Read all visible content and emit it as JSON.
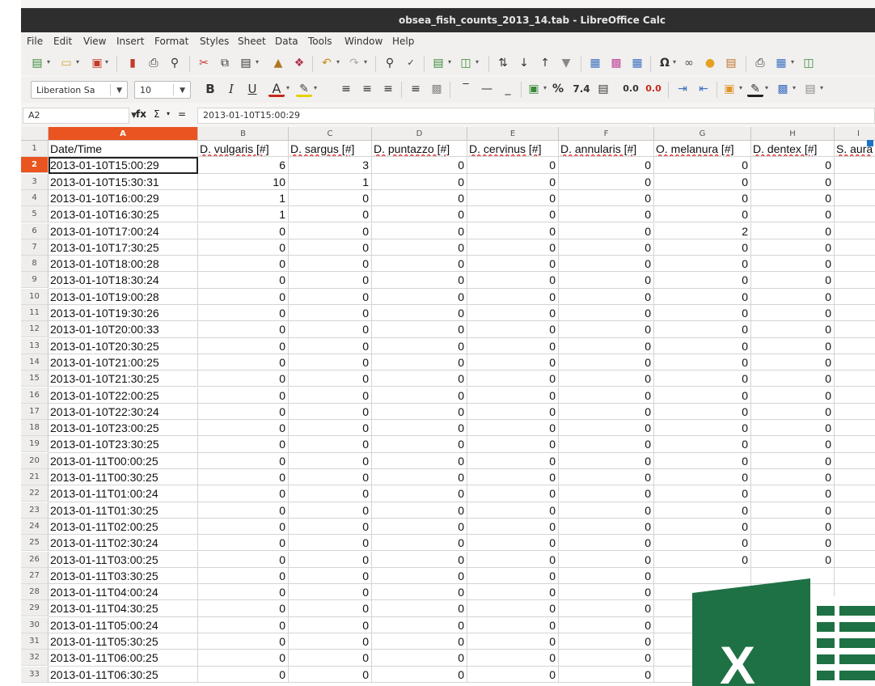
{
  "window": {
    "title": "obsea_fish_counts_2013_14.tab - LibreOffice Calc"
  },
  "menu": [
    "File",
    "Edit",
    "View",
    "Insert",
    "Format",
    "Styles",
    "Sheet",
    "Data",
    "Tools",
    "Window",
    "Help"
  ],
  "formatting": {
    "font_name": "Liberation Sa",
    "font_size": "10",
    "currency": "%",
    "number": "7.4",
    "decimal_add": "0.0",
    "decimal_remove": "0.0"
  },
  "formula_bar": {
    "cell_ref": "A2",
    "fx": "fx",
    "sigma": "Σ",
    "equals": "=",
    "content": "2013-01-10T15:00:29"
  },
  "sheet": {
    "columns": [
      "A",
      "B",
      "C",
      "D",
      "E",
      "F",
      "G",
      "H",
      "I"
    ],
    "headers": [
      "Date/Time",
      "D. vulgaris [#]",
      "D. sargus [#]",
      "D. puntazzo [#]",
      "D. cervinus [#]",
      "D. annularis [#]",
      "O. melanura [#]",
      "D. dentex [#]",
      "S. aura"
    ],
    "rows": [
      {
        "n": "2",
        "date": "2013-01-10T15:00:29",
        "v": [
          "6",
          "3",
          "0",
          "0",
          "0",
          "0",
          "0"
        ]
      },
      {
        "n": "3",
        "date": "2013-01-10T15:30:31",
        "v": [
          "10",
          "1",
          "0",
          "0",
          "0",
          "0",
          "0"
        ]
      },
      {
        "n": "4",
        "date": "2013-01-10T16:00:29",
        "v": [
          "1",
          "0",
          "0",
          "0",
          "0",
          "0",
          "0"
        ]
      },
      {
        "n": "5",
        "date": "2013-01-10T16:30:25",
        "v": [
          "1",
          "0",
          "0",
          "0",
          "0",
          "0",
          "0"
        ]
      },
      {
        "n": "6",
        "date": "2013-01-10T17:00:24",
        "v": [
          "0",
          "0",
          "0",
          "0",
          "0",
          "2",
          "0"
        ]
      },
      {
        "n": "7",
        "date": "2013-01-10T17:30:25",
        "v": [
          "0",
          "0",
          "0",
          "0",
          "0",
          "0",
          "0"
        ]
      },
      {
        "n": "8",
        "date": "2013-01-10T18:00:28",
        "v": [
          "0",
          "0",
          "0",
          "0",
          "0",
          "0",
          "0"
        ]
      },
      {
        "n": "9",
        "date": "2013-01-10T18:30:24",
        "v": [
          "0",
          "0",
          "0",
          "0",
          "0",
          "0",
          "0"
        ]
      },
      {
        "n": "10",
        "date": "2013-01-10T19:00:28",
        "v": [
          "0",
          "0",
          "0",
          "0",
          "0",
          "0",
          "0"
        ]
      },
      {
        "n": "11",
        "date": "2013-01-10T19:30:26",
        "v": [
          "0",
          "0",
          "0",
          "0",
          "0",
          "0",
          "0"
        ]
      },
      {
        "n": "12",
        "date": "2013-01-10T20:00:33",
        "v": [
          "0",
          "0",
          "0",
          "0",
          "0",
          "0",
          "0"
        ]
      },
      {
        "n": "13",
        "date": "2013-01-10T20:30:25",
        "v": [
          "0",
          "0",
          "0",
          "0",
          "0",
          "0",
          "0"
        ]
      },
      {
        "n": "14",
        "date": "2013-01-10T21:00:25",
        "v": [
          "0",
          "0",
          "0",
          "0",
          "0",
          "0",
          "0"
        ]
      },
      {
        "n": "15",
        "date": "2013-01-10T21:30:25",
        "v": [
          "0",
          "0",
          "0",
          "0",
          "0",
          "0",
          "0"
        ]
      },
      {
        "n": "16",
        "date": "2013-01-10T22:00:25",
        "v": [
          "0",
          "0",
          "0",
          "0",
          "0",
          "0",
          "0"
        ]
      },
      {
        "n": "17",
        "date": "2013-01-10T22:30:24",
        "v": [
          "0",
          "0",
          "0",
          "0",
          "0",
          "0",
          "0"
        ]
      },
      {
        "n": "18",
        "date": "2013-01-10T23:00:25",
        "v": [
          "0",
          "0",
          "0",
          "0",
          "0",
          "0",
          "0"
        ]
      },
      {
        "n": "19",
        "date": "2013-01-10T23:30:25",
        "v": [
          "0",
          "0",
          "0",
          "0",
          "0",
          "0",
          "0"
        ]
      },
      {
        "n": "20",
        "date": "2013-01-11T00:00:25",
        "v": [
          "0",
          "0",
          "0",
          "0",
          "0",
          "0",
          "0"
        ]
      },
      {
        "n": "21",
        "date": "2013-01-11T00:30:25",
        "v": [
          "0",
          "0",
          "0",
          "0",
          "0",
          "0",
          "0"
        ]
      },
      {
        "n": "22",
        "date": "2013-01-11T01:00:24",
        "v": [
          "0",
          "0",
          "0",
          "0",
          "0",
          "0",
          "0"
        ]
      },
      {
        "n": "23",
        "date": "2013-01-11T01:30:25",
        "v": [
          "0",
          "0",
          "0",
          "0",
          "0",
          "0",
          "0"
        ]
      },
      {
        "n": "24",
        "date": "2013-01-11T02:00:25",
        "v": [
          "0",
          "0",
          "0",
          "0",
          "0",
          "0",
          "0"
        ]
      },
      {
        "n": "25",
        "date": "2013-01-11T02:30:24",
        "v": [
          "0",
          "0",
          "0",
          "0",
          "0",
          "0",
          "0"
        ]
      },
      {
        "n": "26",
        "date": "2013-01-11T03:00:25",
        "v": [
          "0",
          "0",
          "0",
          "0",
          "0",
          "0",
          "0"
        ]
      },
      {
        "n": "27",
        "date": "2013-01-11T03:30:25",
        "v": [
          "0",
          "0",
          "0",
          "0",
          "0",
          "",
          ""
        ]
      },
      {
        "n": "28",
        "date": "2013-01-11T04:00:24",
        "v": [
          "0",
          "0",
          "0",
          "0",
          "0",
          "",
          ""
        ]
      },
      {
        "n": "29",
        "date": "2013-01-11T04:30:25",
        "v": [
          "0",
          "0",
          "0",
          "0",
          "0",
          "",
          ""
        ]
      },
      {
        "n": "30",
        "date": "2013-01-11T05:00:24",
        "v": [
          "0",
          "0",
          "0",
          "0",
          "0",
          "",
          ""
        ]
      },
      {
        "n": "31",
        "date": "2013-01-11T05:30:25",
        "v": [
          "0",
          "0",
          "0",
          "0",
          "0",
          "",
          ""
        ]
      },
      {
        "n": "32",
        "date": "2013-01-11T06:00:25",
        "v": [
          "0",
          "0",
          "0",
          "0",
          "0",
          "",
          ""
        ]
      },
      {
        "n": "33",
        "date": "2013-01-11T06:30:25",
        "v": [
          "0",
          "0",
          "0",
          "0",
          "0",
          "",
          ""
        ]
      }
    ]
  },
  "colors": {
    "accent": "#e95420",
    "excel_green": "#1e7145",
    "marker": "#1a73c9"
  },
  "logo": {
    "letter": "X"
  }
}
